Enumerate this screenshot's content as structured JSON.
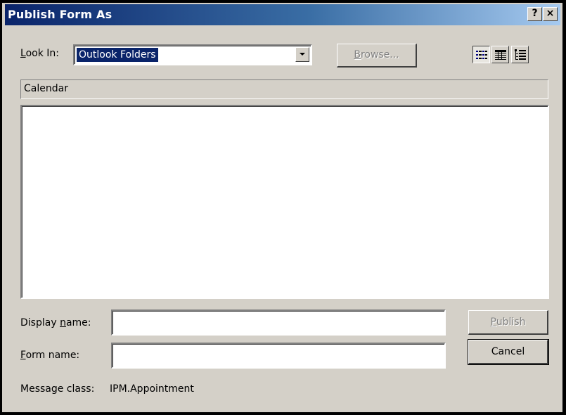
{
  "window": {
    "title": "Publish Form As",
    "help_glyph": "?",
    "close_glyph": "×"
  },
  "look_in": {
    "label_prefix": "",
    "label_key": "L",
    "label_rest": "ook In:",
    "selected": "Outlook Folders"
  },
  "browse": {
    "key": "B",
    "rest": "rowse..."
  },
  "path": "Calendar",
  "display_name": {
    "prefix": "Display ",
    "key": "n",
    "rest": "ame:",
    "value": ""
  },
  "form_name": {
    "key": "F",
    "rest": "orm name:",
    "value": ""
  },
  "publish": {
    "key": "P",
    "rest": "ublish"
  },
  "cancel": {
    "label": "Cancel"
  },
  "message_class": {
    "label": "Message class:",
    "value": "IPM.Appointment"
  },
  "view_buttons": [
    "list-view-icon",
    "details-view-icon",
    "properties-view-icon"
  ],
  "colors": {
    "title_start": "#0a246a",
    "title_end": "#a6caf0",
    "face": "#d4d0c8",
    "selection": "#0a246a"
  }
}
